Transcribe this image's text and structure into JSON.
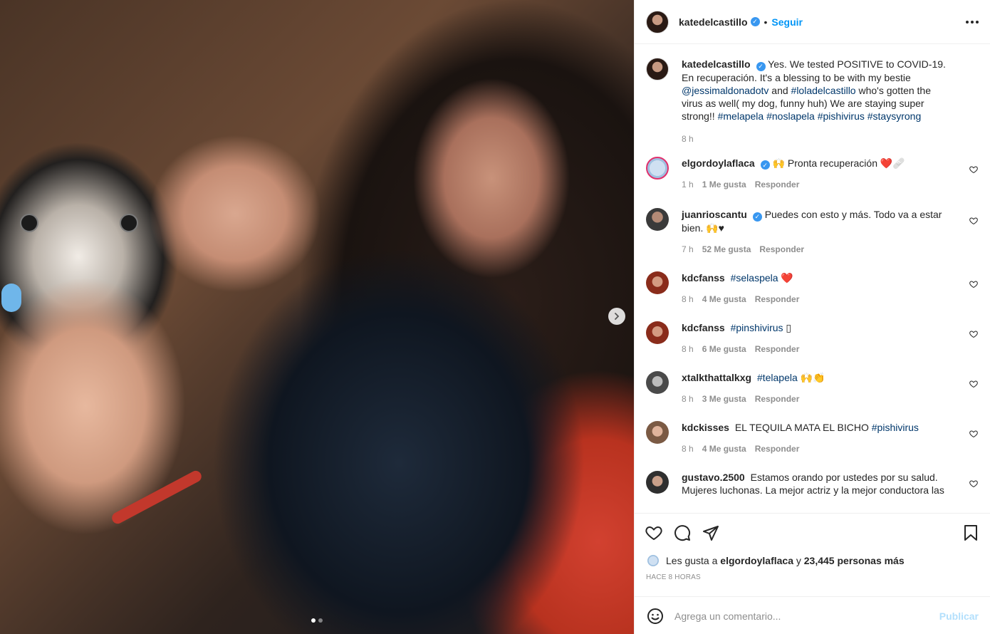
{
  "post": {
    "author": "katedelcastillo",
    "follow_label": "Seguir",
    "separator": "•",
    "carousel": {
      "total": 2,
      "current": 1
    }
  },
  "caption": {
    "username": "katedelcastillo",
    "text_1": "Yes. We tested POSITIVE to COVID-19. En recuperación. It's a blessing to be with my bestie ",
    "mention_1": "@jessimaldonadotv",
    "text_2": " and ",
    "hashtag_1": "#loladelcastillo",
    "text_3": " who's gotten the virus as well( my dog, funny huh) We are staying super strong!! ",
    "hashtag_2": "#melapela",
    "hashtag_3": "#noslapela",
    "hashtag_4": "#pishivirus",
    "hashtag_5": "#staysyrong",
    "time": "8 h"
  },
  "comments": [
    {
      "username": "elgordoylaflaca",
      "verified": true,
      "text": "🙌 Pronta recuperación ❤️🩹",
      "time": "1 h",
      "likes": "1 Me gusta",
      "reply": "Responder"
    },
    {
      "username": "juanrioscantu",
      "verified": true,
      "text": "Puedes con esto y más. Todo va a estar bien. 🙌♥",
      "time": "7 h",
      "likes": "52 Me gusta",
      "reply": "Responder"
    },
    {
      "username": "kdcfanss",
      "verified": false,
      "tag": "#selaspela",
      "text": " ❤️",
      "time": "8 h",
      "likes": "4 Me gusta",
      "reply": "Responder"
    },
    {
      "username": "kdcfanss",
      "verified": false,
      "tag": "#pinshivirus",
      "text": " ▯",
      "time": "8 h",
      "likes": "6 Me gusta",
      "reply": "Responder"
    },
    {
      "username": "xtalkthattalkxg",
      "verified": false,
      "tag": "#telapela",
      "text": " 🙌👏",
      "time": "8 h",
      "likes": "3 Me gusta",
      "reply": "Responder"
    },
    {
      "username": "kdckisses",
      "verified": false,
      "text_before": "EL TEQUILA MATA EL BICHO ",
      "tag": "#pishivirus",
      "time": "8 h",
      "likes": "4 Me gusta",
      "reply": "Responder"
    },
    {
      "username": "gustavo.2500",
      "verified": false,
      "text": "Estamos orando por ustedes por su salud. Mujeres luchonas. La mejor actriz y la mejor conductora las"
    }
  ],
  "likes_line": {
    "prefix": "Les gusta a",
    "user": "elgordoylaflaca",
    "conj": "y",
    "others": "23,445 personas más"
  },
  "time_ago": "HACE 8 HORAS",
  "comment_box": {
    "placeholder": "Agrega un comentario...",
    "publish_label": "Publicar"
  },
  "icons": {
    "like": "heart-icon",
    "comment": "comment-icon",
    "share": "share-icon",
    "save": "bookmark-icon",
    "emoji": "emoji-icon",
    "more": "more-icon",
    "next": "chevron-right-icon"
  },
  "colors": {
    "link": "#00376b",
    "accent": "#0095f6",
    "verified": "#3897f0",
    "muted": "#8e8e8e"
  }
}
